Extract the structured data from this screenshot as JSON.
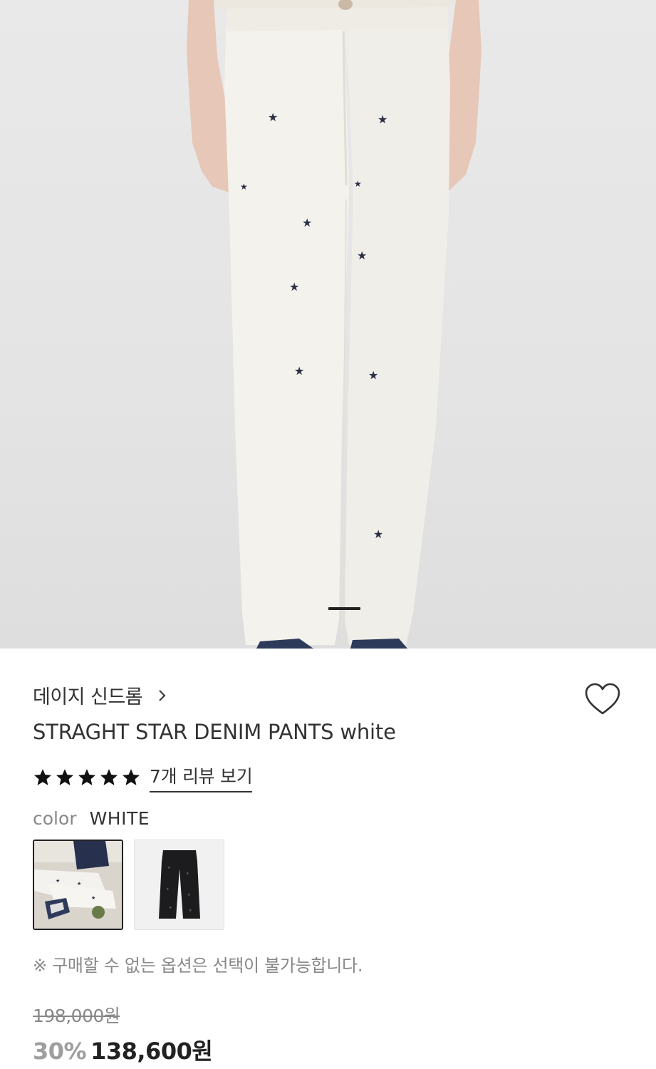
{
  "product": {
    "brand": "데이지 신드롬",
    "brand_chevron_icon": "chevron-right-icon",
    "title": "STRAGHT STAR DENIM PANTS white",
    "wishlist_icon": "heart-outline-icon",
    "rating": {
      "stars": 5,
      "star_color": "#111111",
      "review_link": "7개 리뷰 보기"
    },
    "color": {
      "label": "color",
      "value": "WHITE",
      "swatches": [
        "white-pants-thumbnail",
        "black-pants-thumbnail"
      ]
    },
    "notice": "※ 구매할 수 없는 옵션은 선택이 불가능합니다.",
    "price": {
      "original": "198,000원",
      "discount": "30%",
      "sale": "138,600원"
    }
  },
  "colors": {
    "text": "#333333",
    "muted": "#888888",
    "discount": "#9e9e9e"
  }
}
